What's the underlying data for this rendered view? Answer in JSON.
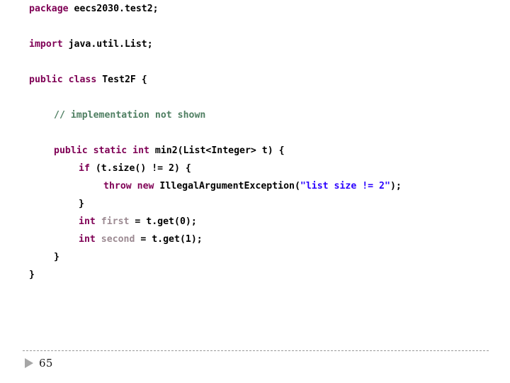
{
  "slide": {
    "background_color": "#ffffff",
    "number": "65"
  },
  "footer": {
    "rule_color": "#9a9a9a",
    "bullet_icon": "triangle-right-icon",
    "bullet_color": "#a6a6a6",
    "page_number": "65"
  },
  "colors": {
    "keyword": "#7f0055",
    "plain": "#000000",
    "comment": "#4f7f62",
    "string": "#2a00ff",
    "local_variable": "#9c8a92"
  },
  "code": {
    "language": "java",
    "plain_text": "package eecs2030.test2;\n\nimport java.util.List;\n\npublic class Test2F {\n\n    // implementation not shown\n\n    public static int min2(List<Integer> t) {\n        if (t.size() != 2) {\n            throw new IllegalArgumentException(\"list size != 2\");\n        }\n        int first = t.get(0);\n        int second = t.get(1);\n    }\n}",
    "lines": [
      {
        "indent": 0,
        "tokens": [
          {
            "t": "package",
            "c": "keyword"
          },
          {
            "t": " eecs2030.test2;",
            "c": "plain"
          }
        ]
      },
      {
        "indent": 0,
        "blank": true,
        "tokens": []
      },
      {
        "indent": 0,
        "tokens": [
          {
            "t": "import",
            "c": "keyword"
          },
          {
            "t": " java.util.List;",
            "c": "plain"
          }
        ]
      },
      {
        "indent": 0,
        "blank": true,
        "tokens": []
      },
      {
        "indent": 0,
        "tokens": [
          {
            "t": "public class",
            "c": "keyword"
          },
          {
            "t": " Test2F {",
            "c": "plain"
          }
        ]
      },
      {
        "indent": 0,
        "blank": true,
        "tokens": []
      },
      {
        "indent": 1,
        "tokens": [
          {
            "t": "// implementation not shown",
            "c": "comment"
          }
        ]
      },
      {
        "indent": 0,
        "blank": true,
        "tokens": []
      },
      {
        "indent": 1,
        "tokens": [
          {
            "t": "public static int",
            "c": "keyword"
          },
          {
            "t": " min2(List<Integer> t) {",
            "c": "plain"
          }
        ]
      },
      {
        "indent": 2,
        "tokens": [
          {
            "t": "if",
            "c": "keyword"
          },
          {
            "t": " (t.size() != 2) {",
            "c": "plain"
          }
        ]
      },
      {
        "indent": 3,
        "tokens": [
          {
            "t": "throw new",
            "c": "keyword"
          },
          {
            "t": " IllegalArgumentException(",
            "c": "plain"
          },
          {
            "t": "\"list size != 2\"",
            "c": "string"
          },
          {
            "t": ");",
            "c": "plain"
          }
        ]
      },
      {
        "indent": 2,
        "tokens": [
          {
            "t": "}",
            "c": "plain"
          }
        ]
      },
      {
        "indent": 2,
        "tokens": [
          {
            "t": "int",
            "c": "keyword"
          },
          {
            "t": " ",
            "c": "plain"
          },
          {
            "t": "first",
            "c": "local"
          },
          {
            "t": " = t.get(0);",
            "c": "plain"
          }
        ]
      },
      {
        "indent": 2,
        "tokens": [
          {
            "t": "int",
            "c": "keyword"
          },
          {
            "t": " ",
            "c": "plain"
          },
          {
            "t": "second",
            "c": "local"
          },
          {
            "t": " = t.get(1);",
            "c": "plain"
          }
        ]
      },
      {
        "indent": 1,
        "tokens": [
          {
            "t": "}",
            "c": "plain"
          }
        ]
      },
      {
        "indent": 0,
        "tokens": [
          {
            "t": "}",
            "c": "plain"
          }
        ]
      }
    ]
  }
}
